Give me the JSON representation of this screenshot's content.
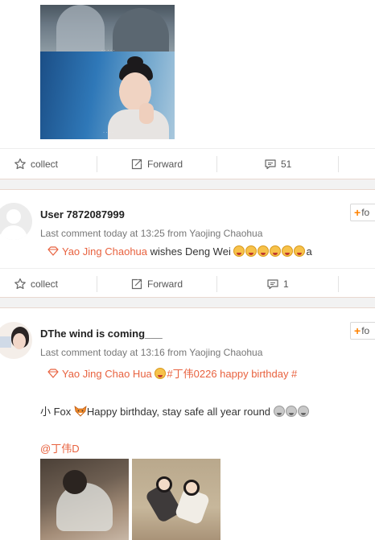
{
  "post_top": {
    "image_caption_1": "· · · · ·",
    "image_caption_2": "· · · ·",
    "actions": {
      "collect": "collect",
      "forward": "Forward",
      "comments": "51"
    }
  },
  "post_1": {
    "username": "User 7872087999",
    "meta": "Last comment today at 13:25 from Yaojing Chaohua",
    "topic": "Yao Jing Chaohua",
    "text": "wishes Deng Wei",
    "text_tail": "a",
    "emoji_count": 6,
    "follow": "fo",
    "actions": {
      "collect": "collect",
      "forward": "Forward",
      "comments": "1"
    }
  },
  "post_2": {
    "username": "DThe wind is coming___",
    "meta": "Last comment today at 13:16 from Yaojing Chaohua",
    "topic": "Yao Jing Chao Hua",
    "topic_tail": "#丁伟0226 happy birthday #",
    "follow": "fo",
    "body_prefix": "小 Fox",
    "body_text": "Happy birthday, stay safe all year round",
    "mention": "@丁伟D"
  },
  "colors": {
    "accent": "#e8623f",
    "follow_plus": "#ff8200"
  }
}
